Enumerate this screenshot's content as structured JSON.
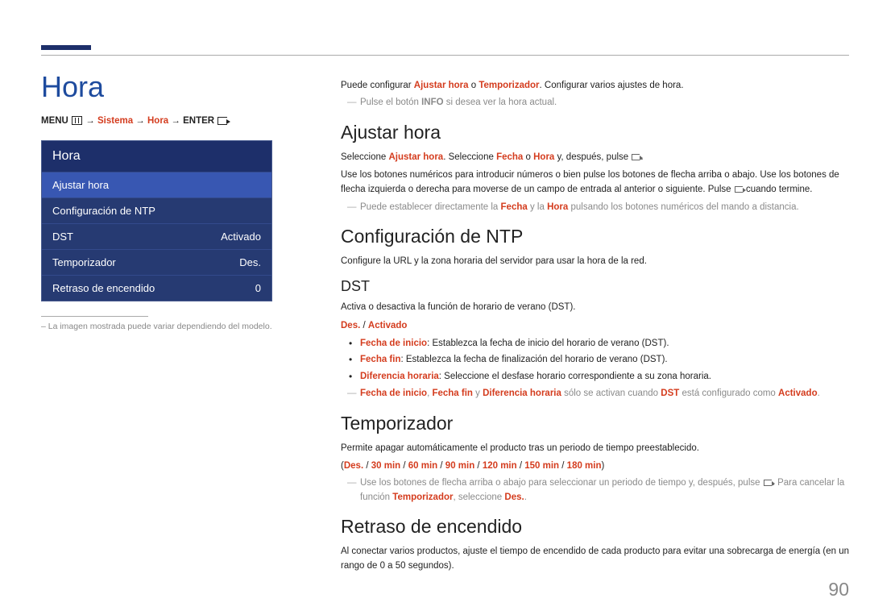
{
  "pageTitle": "Hora",
  "menuPath": {
    "menu": "MENU",
    "sistema": "Sistema",
    "hora": "Hora",
    "enter": "ENTER"
  },
  "osd": {
    "title": "Hora",
    "items": [
      {
        "label": "Ajustar hora",
        "value": ""
      },
      {
        "label": "Configuración de NTP",
        "value": ""
      },
      {
        "label": "DST",
        "value": "Activado"
      },
      {
        "label": "Temporizador",
        "value": "Des."
      },
      {
        "label": "Retraso de encendido",
        "value": "0"
      }
    ],
    "footnote": "–  La imagen mostrada puede variar dependiendo del modelo."
  },
  "intro": {
    "pre": "Puede configurar ",
    "k1": "Ajustar hora",
    "mid": " o ",
    "k2": "Temporizador",
    "post": ". Configurar varios ajustes de hora.",
    "note_pre": "Pulse el botón ",
    "note_key": "INFO",
    "note_post": " si desea ver la hora actual."
  },
  "ajustar": {
    "heading": "Ajustar hora",
    "line1_pre": "Seleccione ",
    "line1_k1": "Ajustar hora",
    "line1_mid": ". Seleccione ",
    "line1_k2": "Fecha",
    "line1_mid2": " o ",
    "line1_k3": "Hora",
    "line1_post": " y, después, pulse ",
    "para": "Use los botones numéricos para introducir números o bien pulse los botones de flecha arriba o abajo. Use los botones de flecha izquierda o derecha para moverse de un campo de entrada al anterior o siguiente. Pulse ",
    "para_post": " cuando termine.",
    "note_pre": "Puede establecer directamente la ",
    "note_k1": "Fecha",
    "note_mid": " y la ",
    "note_k2": "Hora",
    "note_post": " pulsando los botones numéricos del mando a distancia."
  },
  "ntp": {
    "heading": "Configuración de NTP",
    "text": "Configure la URL y la zona horaria del servidor para usar la hora de la red."
  },
  "dst": {
    "heading": "DST",
    "text": "Activa o desactiva la función de horario de verano (DST).",
    "opt1": "Des.",
    "sep": " / ",
    "opt2": "Activado",
    "b1_k": "Fecha de inicio",
    "b1_t": ": Establezca la fecha de inicio del horario de verano (DST).",
    "b2_k": "Fecha fin",
    "b2_t": ": Establezca la fecha de finalización del horario de verano (DST).",
    "b3_k": "Diferencia horaria",
    "b3_t": ": Seleccione el desfase horario correspondiente a su zona horaria.",
    "note_k1": "Fecha de inicio",
    "note_c1": ", ",
    "note_k2": "Fecha fin",
    "note_c2": " y ",
    "note_k3": "Diferencia horaria",
    "note_mid": " sólo se activan cuando ",
    "note_k4": "DST",
    "note_mid2": " está configurado como ",
    "note_k5": "Activado",
    "note_end": "."
  },
  "temp": {
    "heading": "Temporizador",
    "text": "Permite apagar automáticamente el producto tras un periodo de tiempo preestablecido.",
    "opts": [
      "Des.",
      "30 min",
      "60 min",
      "90 min",
      "120 min",
      "150 min",
      "180 min"
    ],
    "note_pre": "Use los botones de flecha arriba o abajo para seleccionar un periodo de tiempo y, después, pulse ",
    "note_mid": ". Para cancelar la función ",
    "note_k1": "Temporizador",
    "note_mid2": ", seleccione ",
    "note_k2": "Des.",
    "note_end": "."
  },
  "retraso": {
    "heading": "Retraso de encendido",
    "text": "Al conectar varios productos, ajuste el tiempo de encendido de cada producto para evitar una sobrecarga de energía (en un rango de 0 a 50 segundos)."
  },
  "pageNumber": "90"
}
